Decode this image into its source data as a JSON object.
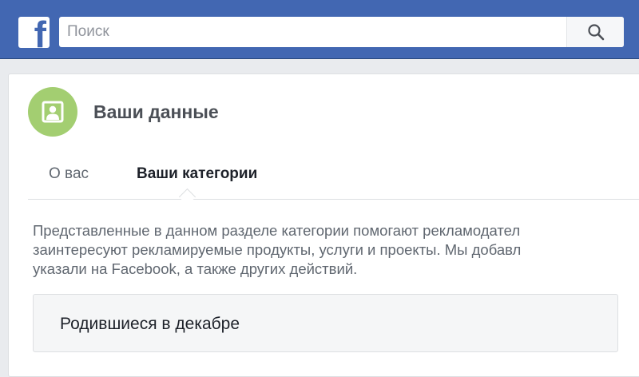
{
  "header": {
    "logo_letter": "f",
    "search": {
      "placeholder": "Поиск",
      "value": ""
    },
    "search_icon": "magnifier-icon",
    "brand_color": "#4267b2"
  },
  "profile": {
    "avatar_icon": "person-portrait-icon",
    "avatar_color": "#a3ce71",
    "title": "Ваши данные"
  },
  "tabs": [
    {
      "label": "О вас",
      "active": false
    },
    {
      "label": "Ваши категории",
      "active": true
    }
  ],
  "description": {
    "lines": [
      "Представленные в данном разделе категории помогают рекламодател",
      "заинтересуют рекламируемые продукты, услуги и проекты. Мы добавл",
      "указали на Facebook, а также других действий."
    ]
  },
  "categories": [
    {
      "label": "Родившиеся в декабре"
    }
  ]
}
